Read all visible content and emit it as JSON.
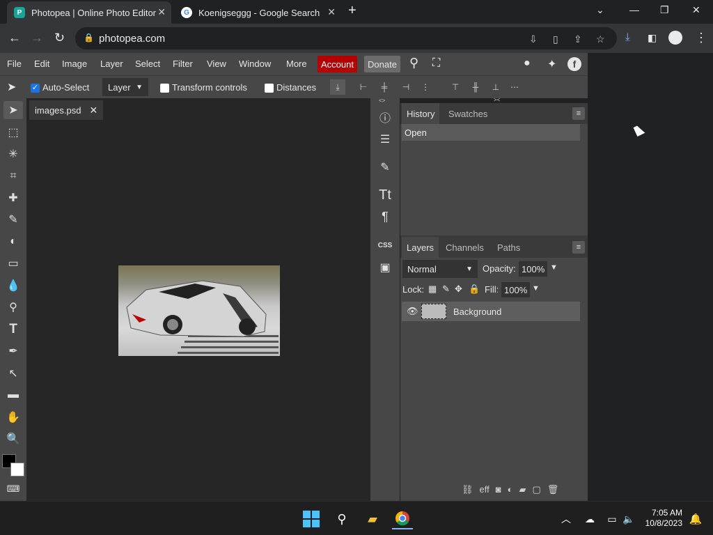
{
  "browser": {
    "tabs": [
      {
        "title": "Photopea | Online Photo Editor",
        "active": true
      },
      {
        "title": "Koenigseggg - Google Search",
        "active": false
      }
    ],
    "new_tab": "+",
    "url": "photopea.com"
  },
  "menu": {
    "items": [
      "File",
      "Edit",
      "Image",
      "Layer",
      "Select",
      "Filter",
      "View",
      "Window",
      "More"
    ],
    "account": "Account",
    "donate": "Donate"
  },
  "options": {
    "auto_select_label": "Auto-Select",
    "auto_select_checked": true,
    "target": "Layer",
    "transform_label": "Transform controls",
    "distances_label": "Distances"
  },
  "document": {
    "tab_title": "images.psd"
  },
  "history": {
    "tabs": [
      "History",
      "Swatches"
    ],
    "entries": [
      "Open"
    ]
  },
  "layers": {
    "tabs": [
      "Layers",
      "Channels",
      "Paths"
    ],
    "blend_mode": "Normal",
    "opacity_label": "Opacity:",
    "opacity": "100%",
    "lock_label": "Lock:",
    "fill_label": "Fill:",
    "fill": "100%",
    "rows": [
      {
        "name": "Background",
        "visible": true
      }
    ]
  },
  "taskbar": {
    "time": "7:05 AM",
    "date": "10/8/2023"
  },
  "colors": {
    "account_bg": "#b40000",
    "panel_bg": "#474747",
    "workspace_bg": "#262626",
    "chrome_bg": "#202124"
  }
}
